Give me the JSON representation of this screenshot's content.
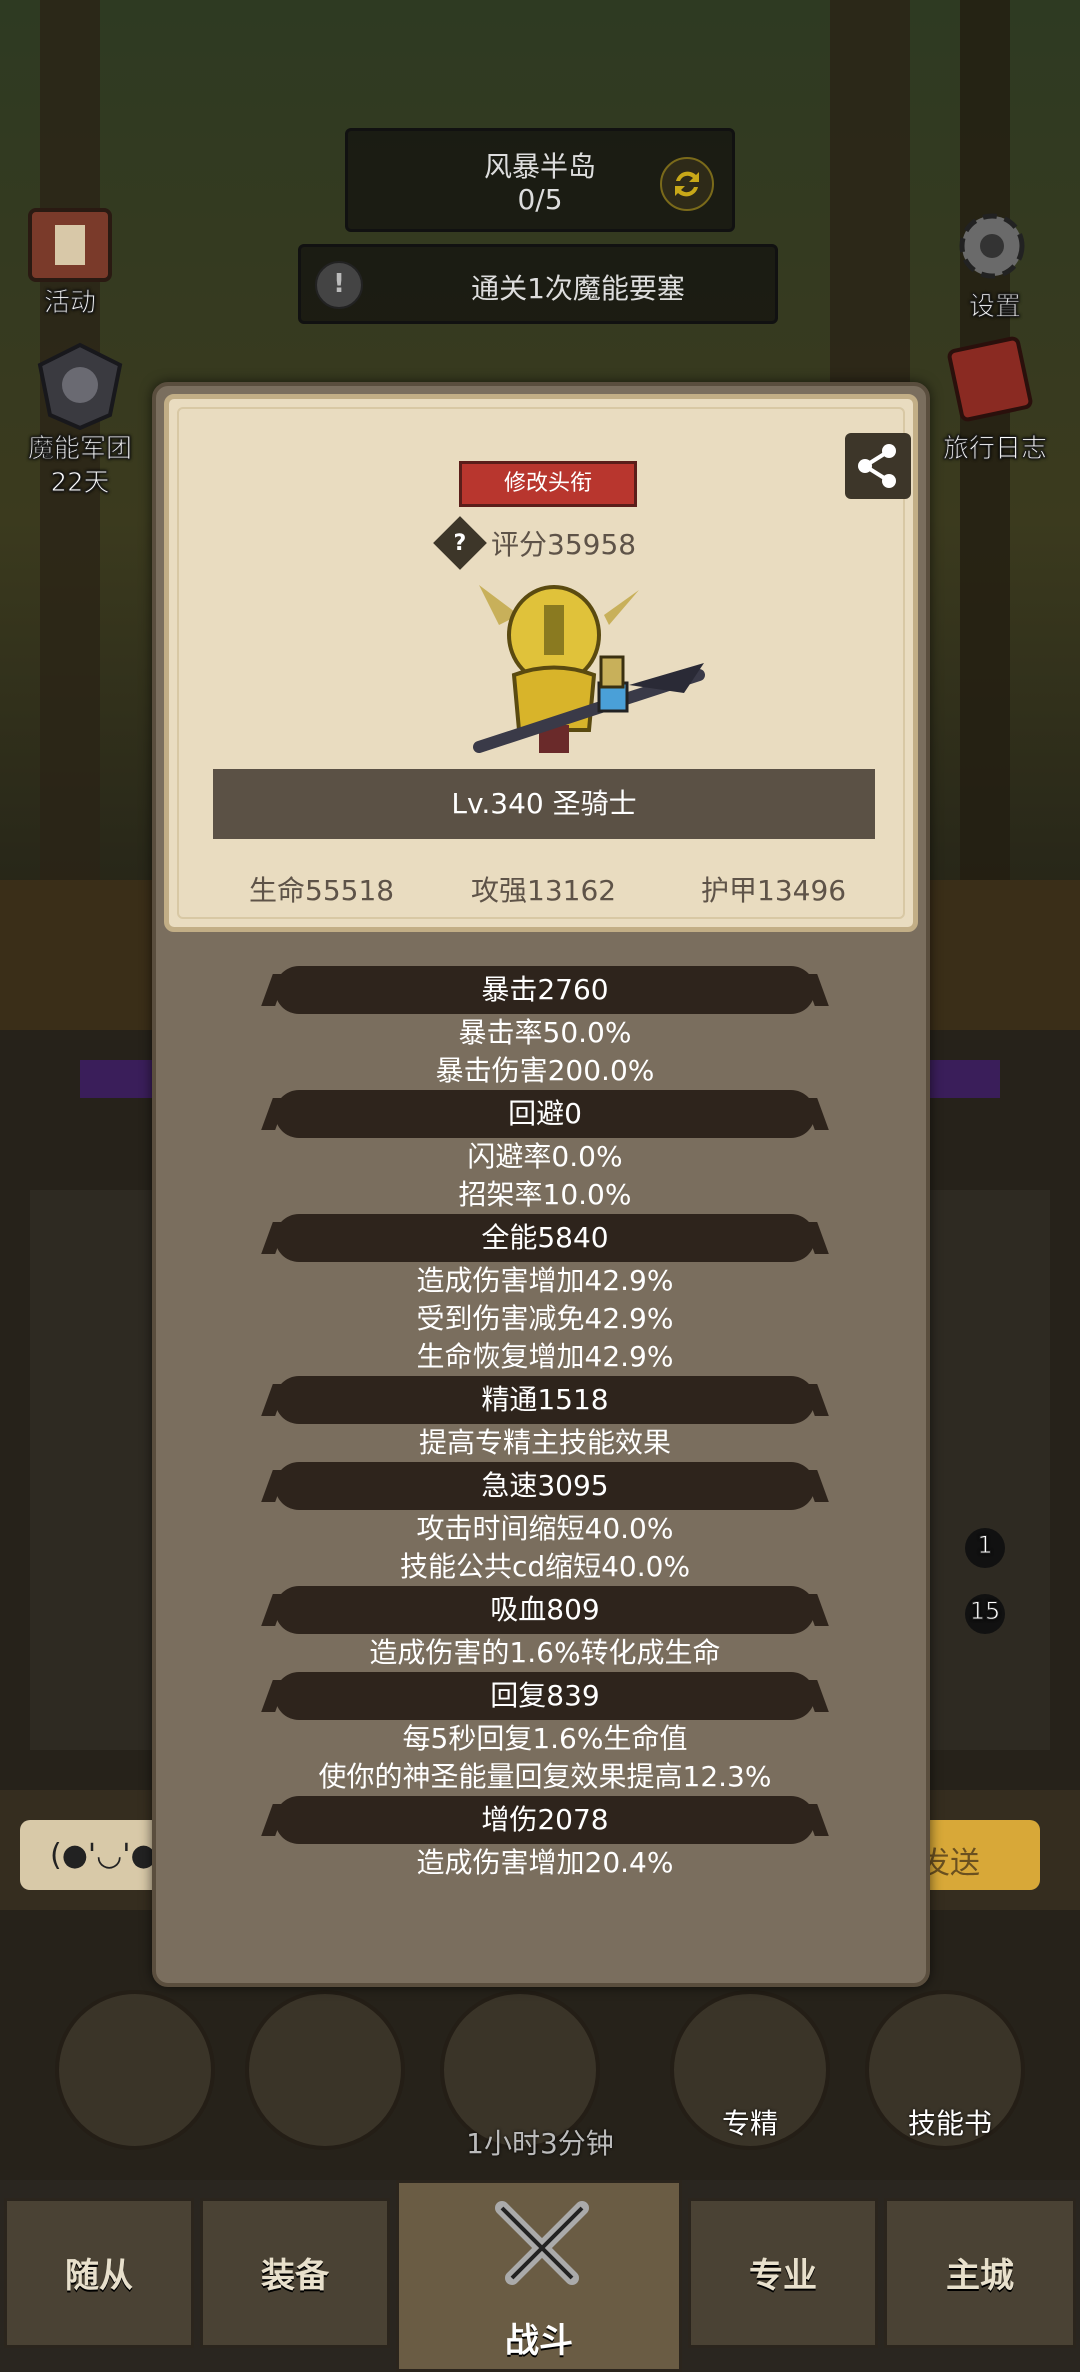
{
  "region": {
    "name": "风暴半岛",
    "progress": "0/5"
  },
  "quest": {
    "text": "通关1次魔能要塞"
  },
  "side": {
    "left": [
      {
        "label": "活动"
      },
      {
        "label": "魔能军团"
      },
      {
        "sub": "22天"
      }
    ],
    "right": [
      {
        "label": "设置"
      },
      {
        "label": "旅行日志"
      }
    ]
  },
  "card": {
    "title_button": "修改头衔",
    "score": "评分35958",
    "level_class": "Lv.340 圣骑士",
    "hp": "生命55518",
    "atk": "攻强13162",
    "armor": "护甲13496"
  },
  "stats": [
    {
      "title": "暴击2760",
      "lines": [
        "暴击率50.0%",
        "暴击伤害200.0%"
      ]
    },
    {
      "title": "回避0",
      "lines": [
        "闪避率0.0%",
        "招架率10.0%"
      ]
    },
    {
      "title": "全能5840",
      "lines": [
        "造成伤害增加42.9%",
        "受到伤害减免42.9%",
        "生命恢复增加42.9%"
      ]
    },
    {
      "title": "精通1518",
      "lines": [
        "提高专精主技能效果"
      ]
    },
    {
      "title": "急速3095",
      "lines": [
        "攻击时间缩短40.0%",
        "技能公共cd缩短40.0%"
      ]
    },
    {
      "title": "吸血809",
      "lines": [
        "造成伤害的1.6%转化成生命"
      ]
    },
    {
      "title": "回复839",
      "lines": [
        "每5秒回复1.6%生命值",
        "使你的神圣能量回复效果提高12.3%"
      ]
    },
    {
      "title": "增伤2078",
      "lines": [
        "造成伤害增加20.4%"
      ]
    }
  ],
  "background_bits": {
    "badge_1": "1",
    "badge_15": "15",
    "chat_emote": "(●'◡'●",
    "send_label": "发送",
    "timer": "1小时3分钟",
    "specialization": "专精",
    "skill_book": "技能书"
  },
  "nav": {
    "followers": "随从",
    "equipment": "装备",
    "fight": "战斗",
    "profession": "专业",
    "city": "主城"
  },
  "colors": {
    "panel": "#7a6e5e",
    "card": "#e9dcc0",
    "title_button": "#b8362e",
    "dark_bar": "#2e241c"
  }
}
